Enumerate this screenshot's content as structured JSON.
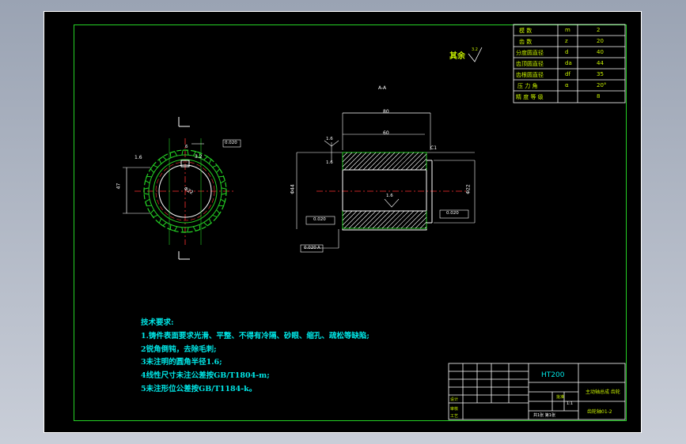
{
  "drawing": {
    "surface_note": "其余",
    "section_marker": "A-A",
    "material": "HT200",
    "part_name": "主动轴总成 齿轮",
    "drawing_no": "齿轮轴01-2"
  },
  "gear_params": [
    {
      "name": "模 数",
      "symbol": "m",
      "value": "2"
    },
    {
      "name": "齿 数",
      "symbol": "z",
      "value": "20"
    },
    {
      "name": "分度圆直径",
      "symbol": "d",
      "value": "40"
    },
    {
      "name": "齿顶圆直径",
      "symbol": "da",
      "value": "44"
    },
    {
      "name": "齿根圆直径",
      "symbol": "df",
      "value": "35"
    },
    {
      "name": "压 力 角",
      "symbol": "α",
      "value": "20°"
    },
    {
      "name": "精 度 等 级",
      "symbol": "",
      "value": "8"
    }
  ],
  "tech_requirements": {
    "title": "技术要求:",
    "items": [
      "1.铸件表面要求光滑、平整、不得有冷隔、砂眼、缩孔、疏松等缺陷;",
      "2锐角倒钝，去除毛刺;",
      "3未注明的圆角半径1.6;",
      "4线性尺寸未注公差按GB/T1804-m;",
      "5未注形位公差按GB/T1184-k。"
    ]
  },
  "dimensions": {
    "length": "80",
    "inner_len": "60",
    "bore_dia": "Φ22",
    "outer_dia": "Φ44",
    "key_width": "6",
    "chamfer": "C1",
    "rough_1": "3.2",
    "rough_2": "1.6",
    "runout_1": "0.020",
    "runout_2": "0.020",
    "datum": "A",
    "left_dim": "47",
    "tol_box": "0.020"
  },
  "title_block": {
    "scale": "1:1",
    "sheet": "共1张 第1张",
    "design": "设计",
    "check": "审核",
    "process": "工艺",
    "approve": "批准"
  }
}
